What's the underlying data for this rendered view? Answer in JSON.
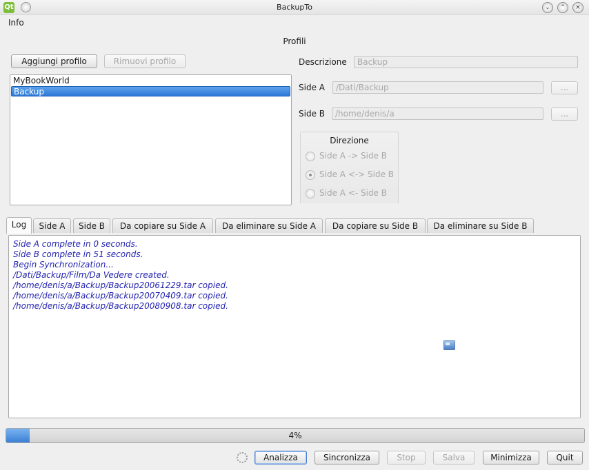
{
  "window": {
    "title": "BackupTo",
    "app_icon": "Qt"
  },
  "menubar": {
    "items": [
      "Info"
    ]
  },
  "profiles": {
    "section_title": "Profili",
    "add_label": "Aggiungi profilo",
    "remove_label": "Rimuovi profilo",
    "list": [
      "MyBookWorld",
      "Backup"
    ],
    "selected_index": 1
  },
  "details": {
    "description_label": "Descrizione",
    "description_value": "Backup",
    "side_a_label": "Side A",
    "side_a_value": "/Dati/Backup",
    "side_b_label": "Side B",
    "side_b_value": "/home/denis/a",
    "browse_label": "...",
    "direction": {
      "title": "Direzione",
      "options": [
        "Side A -> Side B",
        "Side A <-> Side B",
        "Side A <- Side B"
      ],
      "selected_index": 1
    }
  },
  "tabs": [
    "Log",
    "Side A",
    "Side B",
    "Da copiare su Side A",
    "Da eliminare su Side A",
    "Da copiare su Side B",
    "Da eliminare su Side B"
  ],
  "active_tab": 0,
  "log": {
    "lines": [
      "Side A complete in 0 seconds.",
      "Side B complete in 51 seconds.",
      "Begin Synchronization...",
      "/Dati/Backup/Film/Da Vedere created.",
      "/home/denis/a/Backup/Backup20061229.tar copied.",
      "/home/denis/a/Backup/Backup20070409.tar copied.",
      "/home/denis/a/Backup/Backup20080908.tar copied."
    ],
    "text_color": "#2323b0"
  },
  "progress": {
    "value": 4,
    "label": "4%"
  },
  "actions": {
    "analizza": "Analizza",
    "sincronizza": "Sincronizza",
    "stop": "Stop",
    "salva": "Salva",
    "minimizza": "Minimizza",
    "quit": "Quit"
  },
  "colors": {
    "selection": "#2d79d6",
    "progress": "#3b7fd4"
  }
}
